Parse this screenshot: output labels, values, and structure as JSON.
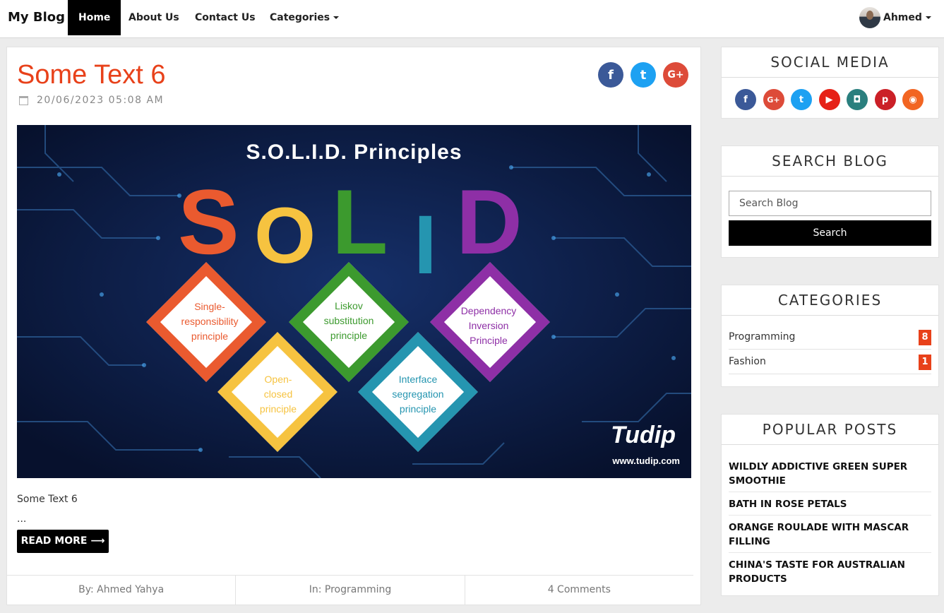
{
  "navbar": {
    "brand": "My Blog",
    "items": [
      {
        "label": "Home",
        "active": true
      },
      {
        "label": "About Us"
      },
      {
        "label": "Contact Us"
      },
      {
        "label": "Categories"
      }
    ],
    "user_name": "Ahmed"
  },
  "post": {
    "title": "Some Text 6",
    "date": "20/06/2023 05:08 AM",
    "share": [
      {
        "icon": "facebook-icon",
        "glyph": "f",
        "color": "#3b5998"
      },
      {
        "icon": "twitter-icon",
        "glyph": "t",
        "color": "#1da1f2"
      },
      {
        "icon": "google-plus-icon",
        "glyph": "G+",
        "color": "#dd4b39"
      }
    ],
    "image": {
      "title": "S.O.L.I.D. Principles",
      "letters": [
        {
          "char": "S",
          "color": "#ea5a2f"
        },
        {
          "char": "O",
          "color": "#f6c340"
        },
        {
          "char": "L",
          "color": "#3c9a2e"
        },
        {
          "char": "I",
          "color": "#2595b0"
        },
        {
          "char": "D",
          "color": "#8e2fa6"
        }
      ],
      "principles": [
        {
          "text": "Single-\nresponsibility\nprinciple",
          "color": "#ea5a2f"
        },
        {
          "text": "Open-\nclosed\nprinciple",
          "color": "#f6c340"
        },
        {
          "text": "Liskov\nsubstitution\nprinciple",
          "color": "#3c9a2e"
        },
        {
          "text": "Interface\nsegregation\nprinciple",
          "color": "#2595b0"
        },
        {
          "text": "Dependency\nInversion\nPrinciple",
          "color": "#8e2fa6"
        }
      ],
      "logo": "Tudip",
      "url": "www.tudip.com"
    },
    "excerpt": "Some Text 6",
    "ellipsis": "...",
    "read_more": "READ MORE ⟶",
    "meta": {
      "author": "By: Ahmed Yahya",
      "category": "In: Programming",
      "comments": "4 Comments"
    }
  },
  "sidebar": {
    "social": {
      "title": "SOCIAL MEDIA",
      "icons": [
        {
          "icon": "facebook-icon",
          "glyph": "f",
          "color": "#3b5998"
        },
        {
          "icon": "google-plus-icon",
          "glyph": "G+",
          "color": "#dd4b39"
        },
        {
          "icon": "twitter-icon",
          "glyph": "t",
          "color": "#1da1f2"
        },
        {
          "icon": "youtube-icon",
          "glyph": "▶",
          "color": "#e62117"
        },
        {
          "icon": "instagram-icon",
          "glyph": "◘",
          "color": "#2a7f7e"
        },
        {
          "icon": "pinterest-icon",
          "glyph": "p",
          "color": "#cb2027"
        },
        {
          "icon": "rss-icon",
          "glyph": "◉",
          "color": "#f26522"
        }
      ]
    },
    "search": {
      "title": "SEARCH BLOG",
      "placeholder": "Search Blog",
      "button": "Search"
    },
    "categories": {
      "title": "CATEGORIES",
      "items": [
        {
          "name": "Programming",
          "count": "8"
        },
        {
          "name": "Fashion",
          "count": "1"
        }
      ]
    },
    "popular": {
      "title": "POPULAR POSTS",
      "items": [
        "WILDLY ADDICTIVE GREEN SUPER SMOOTHIE",
        "BATH IN ROSE PETALS",
        "ORANGE ROULADE WITH MASCAR FILLING",
        "CHINA'S TASTE FOR AUSTRALIAN PRODUCTS"
      ]
    }
  }
}
